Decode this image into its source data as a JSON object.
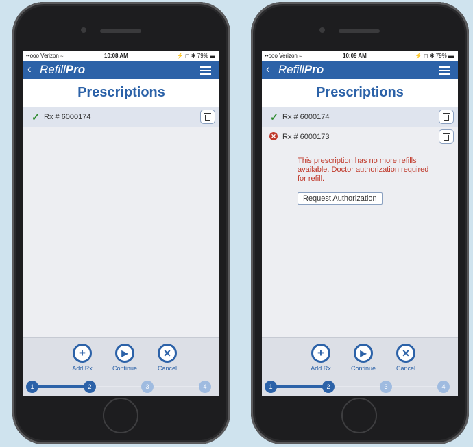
{
  "phones": [
    {
      "status": {
        "carrier": "••ooo Verizon ≈",
        "time": "10:08 AM",
        "right": "⚡ ◻ ✱ 79% ▬"
      },
      "app": {
        "back": "‹",
        "brand_part1": "Refill",
        "brand_part2": "Pro",
        "page_title": "Prescriptions"
      },
      "prescriptions": [
        {
          "status": "ok",
          "label": "Rx # 6000174"
        }
      ],
      "actions": [
        {
          "label": "Add Rx",
          "icon": "+"
        },
        {
          "label": "Continue",
          "icon": "▶"
        },
        {
          "label": "Cancel",
          "icon": "×"
        }
      ],
      "steps": [
        "1",
        "2",
        "3",
        "4"
      ],
      "current_step": 2
    },
    {
      "status": {
        "carrier": "••ooo Verizon ≈",
        "time": "10:09 AM",
        "right": "⚡ ◻ ✱ 79% ▬"
      },
      "app": {
        "back": "‹",
        "brand_part1": "Refill",
        "brand_part2": "Pro",
        "page_title": "Prescriptions"
      },
      "prescriptions": [
        {
          "status": "ok",
          "label": "Rx # 6000174"
        },
        {
          "status": "error",
          "label": "Rx # 6000173",
          "message": "This prescription has no more refills available. Doctor authorization required for refill.",
          "button": "Request Authorization"
        }
      ],
      "actions": [
        {
          "label": "Add Rx",
          "icon": "+"
        },
        {
          "label": "Continue",
          "icon": "▶"
        },
        {
          "label": "Cancel",
          "icon": "×"
        }
      ],
      "steps": [
        "1",
        "2",
        "3",
        "4"
      ],
      "current_step": 2
    }
  ],
  "colors": {
    "primary": "#2c62a8",
    "error": "#c0392b",
    "success": "#2c8a2c"
  }
}
